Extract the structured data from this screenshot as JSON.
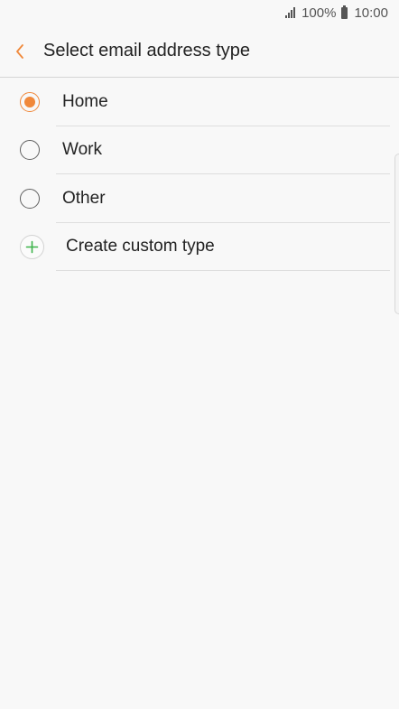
{
  "status_bar": {
    "battery_percent": "100%",
    "time": "10:00"
  },
  "app_bar": {
    "title": "Select email address type"
  },
  "options": [
    {
      "label": "Home",
      "selected": true
    },
    {
      "label": "Work",
      "selected": false
    },
    {
      "label": "Other",
      "selected": false
    }
  ],
  "custom_option": {
    "label": "Create custom type"
  },
  "colors": {
    "accent": "#f0883a",
    "add_icon": "#3cb34a",
    "background": "#f8f8f8"
  },
  "icons": {
    "back": "chevron-left-icon",
    "add": "plus-icon",
    "signal": "signal-icon",
    "battery": "battery-icon"
  }
}
